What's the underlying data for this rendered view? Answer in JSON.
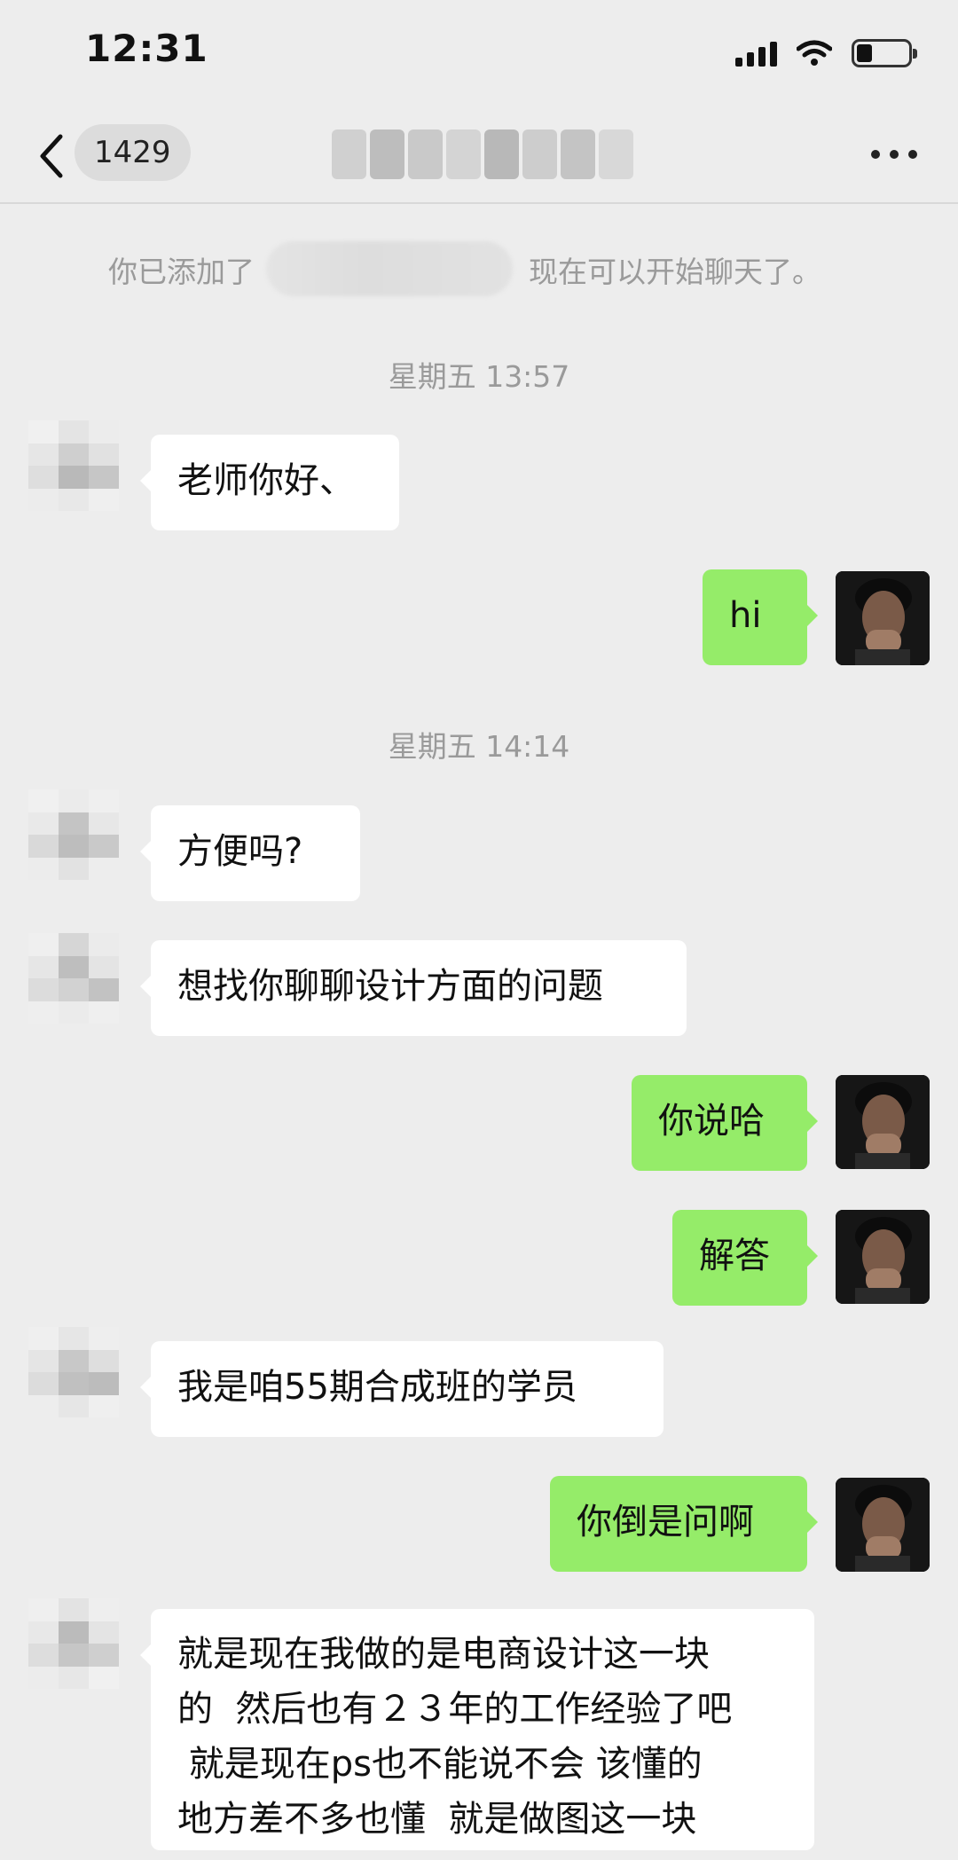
{
  "status_bar": {
    "time": "12:31"
  },
  "nav": {
    "unread_count": "1429"
  },
  "system_notice": {
    "before": "你已添加了",
    "after": "现在可以开始聊天了。"
  },
  "timestamps": [
    "星期五 13:57",
    "星期五 14:14"
  ],
  "messages": [
    {
      "from": "contact",
      "text": "老师你好、"
    },
    {
      "from": "me",
      "text": "hi"
    },
    {
      "from": "contact",
      "text": "方便吗?"
    },
    {
      "from": "contact",
      "text": "想找你聊聊设计方面的问题"
    },
    {
      "from": "me",
      "text": "你说哈"
    },
    {
      "from": "me",
      "text": "解答"
    },
    {
      "from": "contact",
      "text": "我是咱55期合成班的学员"
    },
    {
      "from": "me",
      "text": "你倒是问啊"
    },
    {
      "from": "contact",
      "lines": [
        "就是现在我做的是电商设计这一块",
        "的  然后也有２３年的工作经验了吧",
        " 就是现在ps也不能说不会 该懂的",
        "地方差不多也懂  就是做图这一块"
      ]
    }
  ],
  "colors": {
    "background": "#ededed",
    "bubble_me": "#95ec69",
    "bubble_contact": "#ffffff"
  },
  "icons": {
    "back": "chevron-left-icon",
    "more": "more-dots-icon",
    "signal": "cellular-signal-icon",
    "wifi": "wifi-icon",
    "battery": "battery-icon"
  }
}
